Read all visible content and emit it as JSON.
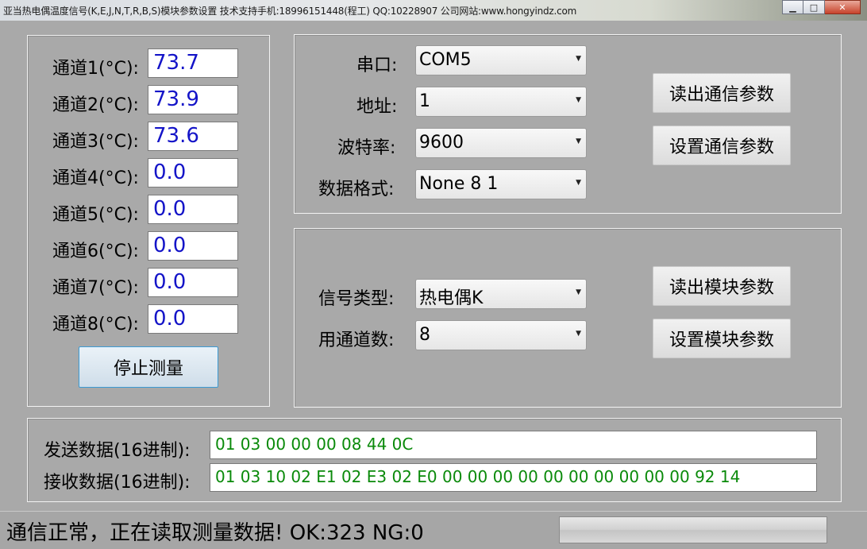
{
  "window": {
    "title": "亚当热电偶温度信号(K,E,J,N,T,R,B,S)模块参数设置    技术支持手机:18996151448(程工)  QQ:10228907   公司网站:www.hongyindz.com",
    "minimize": "▁",
    "maximize": "□",
    "close": "✕"
  },
  "channels": [
    {
      "label": "通道1(°C):",
      "value": "73.7"
    },
    {
      "label": "通道2(°C):",
      "value": "73.9"
    },
    {
      "label": "通道3(°C):",
      "value": "73.6"
    },
    {
      "label": "通道4(°C):",
      "value": "0.0"
    },
    {
      "label": "通道5(°C):",
      "value": "0.0"
    },
    {
      "label": "通道6(°C):",
      "value": "0.0"
    },
    {
      "label": "通道7(°C):",
      "value": "0.0"
    },
    {
      "label": "通道8(°C):",
      "value": "0.0"
    }
  ],
  "stop_button": "停止测量",
  "comm": {
    "port_label": "串口:",
    "port_value": "COM5",
    "address_label": "地址:",
    "address_value": "1",
    "baud_label": "波特率:",
    "baud_value": "9600",
    "format_label": "数据格式:",
    "format_value": "None 8 1",
    "read_button": "读出通信参数",
    "set_button": "设置通信参数"
  },
  "module": {
    "signal_label": "信号类型:",
    "signal_value": "热电偶K",
    "channels_label": "用通道数:",
    "channels_value": "8",
    "read_button": "读出模块参数",
    "set_button": "设置模块参数"
  },
  "hex": {
    "send_label": "发送数据(16进制):",
    "send_value": "01 03 00 00 00 08 44 0C",
    "recv_label": "接收数据(16进制):",
    "recv_value": "01 03 10 02 E1 02 E3 02 E0 00 00 00 00 00 00 00 00 00 00 92 14"
  },
  "status": {
    "text": "通信正常，正在读取测量数据!  OK:323  NG:0",
    "progress": 0
  },
  "colors": {
    "value_text": "#1414c8",
    "hex_text": "#0a8a0a"
  }
}
